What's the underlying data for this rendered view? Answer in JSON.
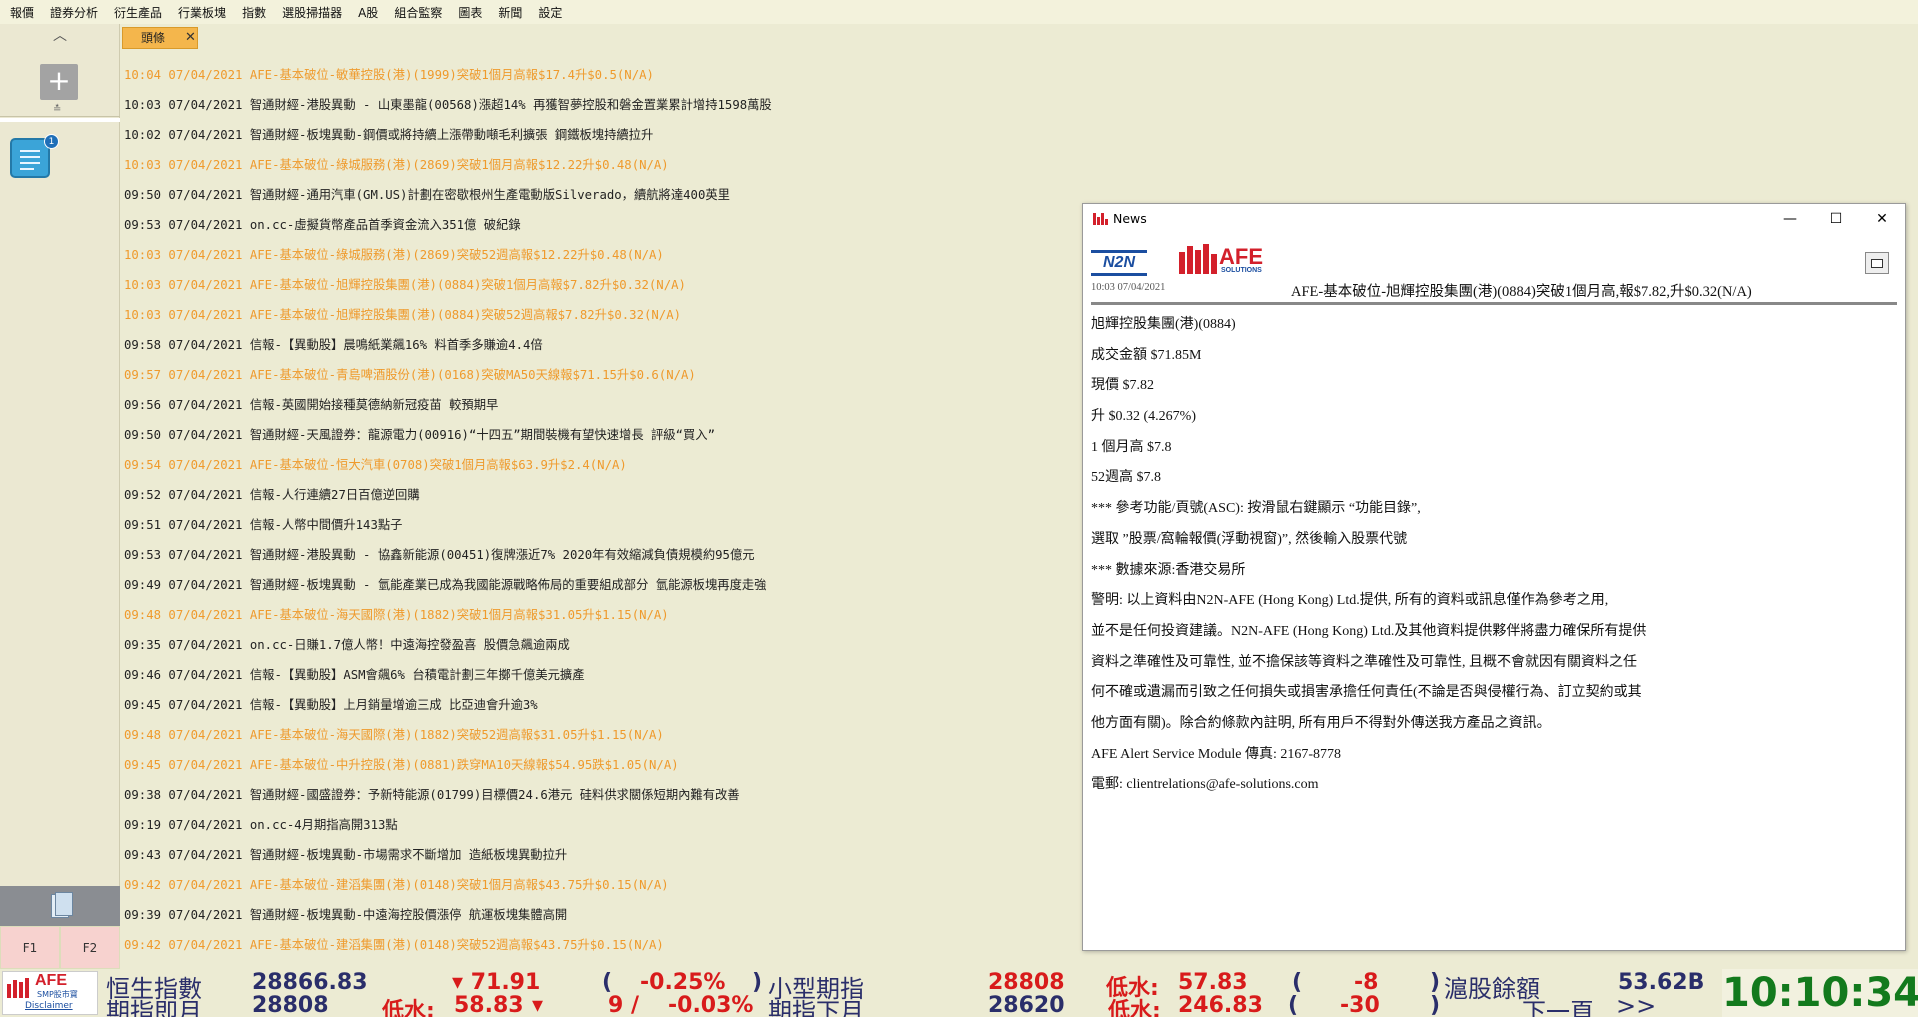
{
  "menu": [
    "報價",
    "證券分析",
    "衍生產品",
    "行業板塊",
    "指數",
    "選股掃描器",
    "A股",
    "組合監察",
    "圖表",
    "新聞",
    "設定"
  ],
  "sidebar": {
    "up_arrow": "^",
    "add_label": "+",
    "resize_label": "≛",
    "news_badge": "1",
    "fkeys": [
      "F1",
      "F2"
    ]
  },
  "tab": {
    "label": "頭條",
    "close": "✕"
  },
  "news_rows": [
    {
      "text": "10:04 07/04/2021 AFE-基本破位-敏華控股(港)(1999)突破1個月高報$17.4升$0.5(N/A)",
      "afe": true
    },
    {
      "text": "10:03 07/04/2021 智通財經-港股異動 - 山東墨龍(00568)漲超14% 再獲智夢控股和磐金置業累計增持1598萬股",
      "afe": false
    },
    {
      "text": "10:02 07/04/2021 智通財經-板塊異動-鋼價或將持續上漲帶動噸毛利擴張 鋼鐵板塊持續拉升",
      "afe": false
    },
    {
      "text": "10:03 07/04/2021 AFE-基本破位-綠城服務(港)(2869)突破1個月高報$12.22升$0.48(N/A)",
      "afe": true
    },
    {
      "text": "09:50 07/04/2021 智通財經-通用汽車(GM.US)計劃在密歇根州生產電動版Silverado，續航將達400英里",
      "afe": false
    },
    {
      "text": "09:53 07/04/2021 on.cc-虛擬貨幣產品首季資金流入351億  破紀錄",
      "afe": false
    },
    {
      "text": "10:03 07/04/2021 AFE-基本破位-綠城服務(港)(2869)突破52週高報$12.22升$0.48(N/A)",
      "afe": true
    },
    {
      "text": "10:03 07/04/2021 AFE-基本破位-旭輝控股集團(港)(0884)突破1個月高報$7.82升$0.32(N/A)",
      "afe": true
    },
    {
      "text": "10:03 07/04/2021 AFE-基本破位-旭輝控股集團(港)(0884)突破52週高報$7.82升$0.32(N/A)",
      "afe": true
    },
    {
      "text": "09:58 07/04/2021 信報-【異動股】晨鳴紙業飆16% 料首季多賺逾4.4倍",
      "afe": false
    },
    {
      "text": "09:57 07/04/2021 AFE-基本破位-青島啤酒股份(港)(0168)突破MA50天線報$71.15升$0.6(N/A)",
      "afe": true
    },
    {
      "text": "09:56 07/04/2021 信報-英國開始接種莫德納新冠疫苗 較預期早",
      "afe": false
    },
    {
      "text": "09:50 07/04/2021 智通財經-天風證券：龍源電力(00916)“十四五”期間裝機有望快速增長 評級“買入”",
      "afe": false
    },
    {
      "text": "09:54 07/04/2021 AFE-基本破位-恒大汽車(0708)突破1個月高報$63.9升$2.4(N/A)",
      "afe": true
    },
    {
      "text": "09:52 07/04/2021 信報-人行連續27日百億逆回購",
      "afe": false
    },
    {
      "text": "09:51 07/04/2021 信報-人幣中間價升143點子",
      "afe": false
    },
    {
      "text": "09:53 07/04/2021 智通財經-港股異動 - 協鑫新能源(00451)復牌漲近7% 2020年有效縮減負債規模約95億元",
      "afe": false
    },
    {
      "text": "09:49 07/04/2021 智通財經-板塊異動 - 氫能產業已成為我國能源戰略佈局的重要組成部分 氫能源板塊再度走強",
      "afe": false
    },
    {
      "text": "09:48 07/04/2021 AFE-基本破位-海天國際(港)(1882)突破1個月高報$31.05升$1.15(N/A)",
      "afe": true
    },
    {
      "text": "09:35 07/04/2021 on.cc-日賺1.7億人幣！中遠海控發盈喜  股價急飆逾兩成",
      "afe": false
    },
    {
      "text": "09:46 07/04/2021 信報-【異動股】ASM會飆6% 台積電計劃三年擲千億美元擴產",
      "afe": false
    },
    {
      "text": "09:45 07/04/2021 信報-【異動股】上月銷量增逾三成 比亞迪會升逾3%",
      "afe": false
    },
    {
      "text": "09:48 07/04/2021 AFE-基本破位-海天國際(港)(1882)突破52週高報$31.05升$1.15(N/A)",
      "afe": true
    },
    {
      "text": "09:45 07/04/2021 AFE-基本破位-中升控股(港)(0881)跌穿MA10天線報$54.95跌$1.05(N/A)",
      "afe": true
    },
    {
      "text": "09:38 07/04/2021 智通財經-國盛證券：予新特能源(01799)目標價24.6港元 硅料供求關係短期內難有改善",
      "afe": false
    },
    {
      "text": "09:19 07/04/2021 on.cc-4月期指高開313點",
      "afe": false
    },
    {
      "text": "09:43 07/04/2021 智通財經-板塊異動-市場需求不斷增加 造紙板塊異動拉升",
      "afe": false
    },
    {
      "text": "09:42 07/04/2021 AFE-基本破位-建滔集團(港)(0148)突破1個月高報$43.75升$0.15(N/A)",
      "afe": true
    },
    {
      "text": "09:39 07/04/2021 智通財經-板塊異動-中遠海控股價漲停 航運板塊集體高開",
      "afe": false
    },
    {
      "text": "09:42 07/04/2021 AFE-基本破位-建滔集團(港)(0148)突破52週高報$43.75升$0.15(N/A)",
      "afe": true
    }
  ],
  "news_window": {
    "title": "News",
    "controls": {
      "minimize": "—",
      "maximize": "☐",
      "close": "✕"
    },
    "logo_n2n": "N2N",
    "logo_afe": "AFE",
    "logo_afe_sub": "SOLUTIONS",
    "time": "10:03 07/04/2021",
    "headline": "AFE-基本破位-旭輝控股集團(港)(0884)突破1個月高,報$7.82,升$0.32(N/A)",
    "body": [
      "旭輝控股集團(港)(0884)",
      "成交金額 $71.85M",
      "現價 $7.82",
      "升   $0.32 (4.267%)",
      "1 個月高 $7.8",
      "52週高   $7.8",
      "*** 參考功能/頁號(ASC): 按滑鼠右鍵顯示 “功能目錄”,",
      "    選取 ”股票/窩輪報價(浮動視窗)”, 然後輸入股票代號",
      "*** 數據來源:香港交易所",
      "警明: 以上資料由N2N-AFE (Hong Kong) Ltd.提供, 所有的資料或訊息僅作為參考之用,",
      "並不是任何投資建議。N2N-AFE (Hong Kong) Ltd.及其他資料提供夥伴將盡力確保所有提供",
      "資料之準確性及可靠性, 並不擔保該等資料之準確性及可靠性, 且概不會就因有關資料之任",
      "何不確或遺漏而引致之任何損失或損害承擔任何責任(不論是否與侵權行為、訂立契約或其",
      "他方面有關)。除合約條款內註明, 所有用戶不得對外傳送我方產品之資訊。",
      "AFE Alert Service Module  傳真: 2167-8778",
      "電郵: clientrelations@afe-solutions.com"
    ]
  },
  "ticker": {
    "logo_afe": "AFE",
    "logo_smp": "SMP股市寶",
    "disclaimer": "Disclaimer",
    "hsi_label": "恒生指數",
    "hsi_value": "28866.83",
    "hsi_change": "▾ 71.91",
    "hsi_pct_open": "(",
    "hsi_pct": "-0.25%",
    "hsi_pct_close": ")",
    "mini_label": "小型期指",
    "mini_value": "28808",
    "mini_disc_label": "低水:",
    "mini_disc": "57.83",
    "mini_open": "(",
    "mini_change": "-8",
    "mini_close": ")",
    "sh_label": "滬股餘額",
    "sh_value": "53.62B",
    "fut_label": "期指即月",
    "fut_value": "28808",
    "fut_disc_label": "低水:",
    "fut_disc": "58.83",
    "fut_arrow": "▾",
    "fut_change": "9 /",
    "fut_pct": "-0.03%",
    "next_label": "期指下月",
    "next_value": "28620",
    "next_disc_label": "低水:",
    "next_disc": "246.83",
    "next_open": "(",
    "next_change": "-30",
    "next_close": ")",
    "next_page": "下一頁",
    "next_arrow": ">>",
    "clock": "10:10:34"
  },
  "colors": {
    "afe_orange": "#ef9a2c",
    "ticker_red": "#d81b1b",
    "ticker_navy": "#2a2e6a",
    "clock_green": "#137a1d"
  }
}
